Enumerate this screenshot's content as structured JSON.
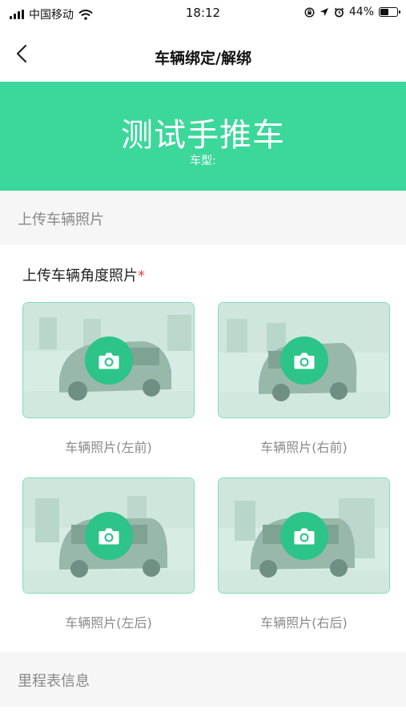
{
  "status_bar": {
    "carrier": "中国移动",
    "time": "18:12",
    "battery_text": "44%",
    "battery_level": 0.44
  },
  "nav": {
    "title": "车辆绑定/解绑",
    "back_icon": "chevron-left-icon"
  },
  "hero": {
    "vehicle_name": "测试手推车",
    "vehicle_type_label": "车型:"
  },
  "sections": {
    "upload_header": "上传车辆照片",
    "odometer_header": "里程表信息"
  },
  "upload": {
    "label": "上传车辆角度照片",
    "required_mark": "*",
    "photos": [
      {
        "caption": "车辆照片(左前)"
      },
      {
        "caption": "车辆照片(右前)"
      },
      {
        "caption": "车辆照片(左后)"
      },
      {
        "caption": "车辆照片(右后)"
      }
    ]
  },
  "colors": {
    "accent": "#3cd79b",
    "camera_button": "#2cc489",
    "required": "#e0443e"
  }
}
